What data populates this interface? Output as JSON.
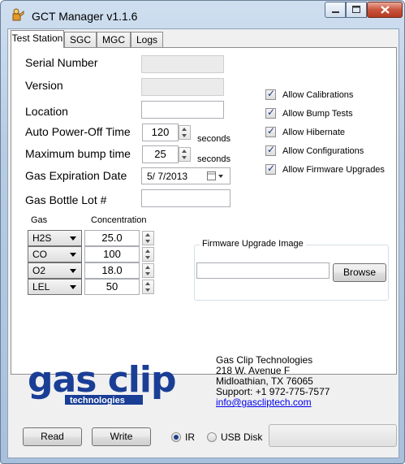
{
  "window": {
    "title": "GCT Manager v1.1.6"
  },
  "tabs": [
    {
      "label": "Test Station",
      "active": true
    },
    {
      "label": "SGC",
      "active": false
    },
    {
      "label": "MGC",
      "active": false
    },
    {
      "label": "Logs",
      "active": false
    }
  ],
  "form": {
    "serial_label": "Serial Number",
    "serial_value": "",
    "version_label": "Version",
    "version_value": "",
    "location_label": "Location",
    "location_value": "",
    "autopoweroff_label": "Auto Power-Off Time",
    "autopoweroff_value": "120",
    "autopoweroff_unit": "seconds",
    "bump_label": "Maximum bump time",
    "bump_value": "25",
    "bump_unit": "seconds",
    "expiration_label": "Gas Expiration Date",
    "expiration_value": "5/ 7/2013",
    "lot_label": "Gas Bottle Lot #",
    "lot_value": ""
  },
  "checkboxes": [
    {
      "label": "Allow Calibrations",
      "checked": true
    },
    {
      "label": "Allow Bump Tests",
      "checked": true
    },
    {
      "label": "Allow Hibernate",
      "checked": true
    },
    {
      "label": "Allow Configurations",
      "checked": true
    },
    {
      "label": "Allow Firmware Upgrades",
      "checked": true
    }
  ],
  "gas_table": {
    "gas_header": "Gas",
    "conc_header": "Concentration",
    "rows": [
      {
        "gas": "H2S",
        "concentration": "25.0"
      },
      {
        "gas": "CO",
        "concentration": "100"
      },
      {
        "gas": "O2",
        "concentration": "18.0"
      },
      {
        "gas": "LEL",
        "concentration": "50"
      }
    ]
  },
  "firmware": {
    "legend": "Firmware Upgrade Image",
    "path_value": "",
    "browse_label": "Browse"
  },
  "company": {
    "logo_text": "gas clip",
    "logo_sub": "technologies",
    "name": "Gas Clip Technologies",
    "address1": "218 W. Avenue F",
    "address2": "Midloathian,  TX  76065",
    "support": "Support:  +1  972-775-7577",
    "email": "info@gascliptech.com"
  },
  "bottom": {
    "read_label": "Read",
    "write_label": "Write",
    "ir_label": "IR",
    "usb_label": "USB Disk",
    "selected_mode": "IR"
  },
  "colors": {
    "logo_blue": "#1a3e96",
    "link": "#0000ee"
  }
}
